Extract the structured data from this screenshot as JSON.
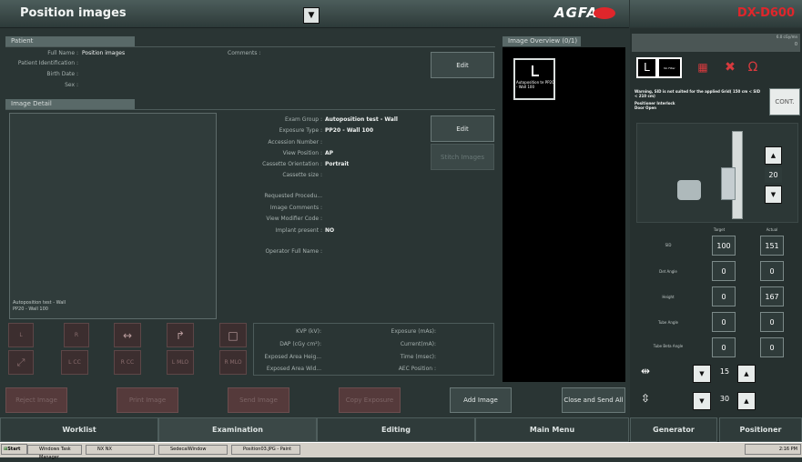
{
  "header": {
    "title": "Position images",
    "brand": "AGFA",
    "device": "DX-",
    "device_model": "D600"
  },
  "patient": {
    "section": "Patient",
    "full_name_label": "Full Name :",
    "full_name": "Position images",
    "id_label": "Patient Identification :",
    "birth_label": "Birth Date :",
    "sex_label": "Sex :",
    "comments_label": "Comments :",
    "edit": "Edit"
  },
  "image_overview": {
    "title": "Image Overview (0/1)",
    "thumb_label": "Autoposition te PP20 - Wall 100"
  },
  "image_detail": {
    "section": "Image Detail",
    "preview_caption_1": "Autoposition test - Wall",
    "preview_caption_2": "PP20 - Wall 100",
    "fields": [
      {
        "label": "Exam Group :",
        "value": "Autoposition test - Wall"
      },
      {
        "label": "Exposure Type :",
        "value": "PP20 - Wall 100"
      },
      {
        "label": "Accession Number :",
        "value": ""
      },
      {
        "label": "View Position :",
        "value": "AP"
      },
      {
        "label": "Cassette Orientation :",
        "value": "Portrait"
      },
      {
        "label": "Cassette size :",
        "value": ""
      },
      {
        "label": "Requested Procedu...",
        "value": ""
      },
      {
        "label": "Image Comments :",
        "value": ""
      },
      {
        "label": "View Modifier Code :",
        "value": ""
      },
      {
        "label": "Implant present :",
        "value": "NO"
      },
      {
        "label": "Operator Full Name :",
        "value": ""
      }
    ],
    "edit": "Edit",
    "stitch": "Stitch Images"
  },
  "tools": [
    "L",
    "R",
    "↔",
    "↱",
    "□",
    "⤢",
    "L CC",
    "R CC",
    "L MLO",
    "R MLO"
  ],
  "exposure": {
    "kvp": "KVP (kV):",
    "dap": "DAP (cGy cm²):",
    "area_h": "Exposed Area Heig...",
    "area_w": "Exposed Area Wid...",
    "mas": "Exposure (mAs):",
    "current": "Current(mA):",
    "time": "Time (msec):",
    "aec": "AEC Position :"
  },
  "actions": {
    "reject": "Reject Image",
    "print": "Print Image",
    "send": "Send Image",
    "copy": "Copy Exposure",
    "add": "Add Image",
    "close": "Close and Send All"
  },
  "tabs": [
    "Worklist",
    "Examination",
    "Editing",
    "Main Menu"
  ],
  "right": {
    "grid_label": "6.0 cGy/mn",
    "grid_value": "0",
    "filter": "No Filter",
    "warning": "Warning, SID is not suited for the applied Grid( 150 cm < SID < 210 cm)",
    "positioner_interlock": "Positioner Interlock",
    "door_open": "Door Open",
    "cont": "CONT.",
    "height_display": "20",
    "target_label": "Target",
    "actual_label": "Actual",
    "rows": [
      {
        "label": "SID",
        "target": "100",
        "actual": "151"
      },
      {
        "label": "Det Angle",
        "target": "0",
        "actual": "0"
      },
      {
        "label": "Height",
        "target": "0",
        "actual": "167"
      },
      {
        "label": "Tube Angle",
        "target": "0",
        "actual": "0"
      },
      {
        "label": "Tube Beta Angle",
        "target": "0",
        "actual": "0"
      }
    ],
    "collim_h": "15",
    "collim_v": "30",
    "tabs": [
      "Generator",
      "Positioner"
    ]
  },
  "taskbar": {
    "start": "Start",
    "items": [
      "Windows Task Manager",
      "NX NX",
      "SedecalWindow",
      "Position03.JPG - Paint"
    ],
    "time": "2:16 PM"
  }
}
